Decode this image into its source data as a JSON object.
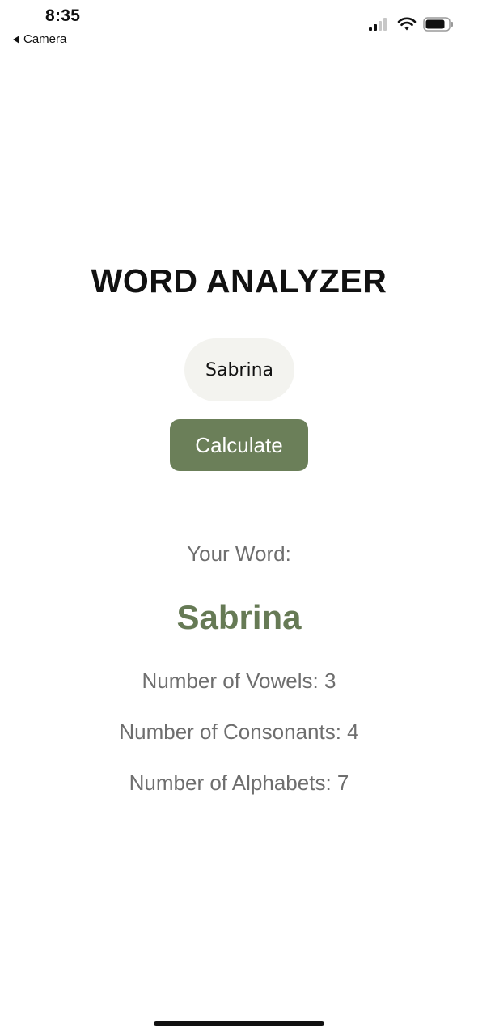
{
  "status_bar": {
    "time": "8:35",
    "back_label": "Camera",
    "icons": [
      "signal-icon",
      "wifi-icon",
      "battery-icon"
    ]
  },
  "app": {
    "title": "WORD ANALYZER",
    "input_value": "Sabrina",
    "calculate_label": "Calculate"
  },
  "result": {
    "label": "Your Word:",
    "word": "Sabrina",
    "vowels_line": "Number of Vowels: 3",
    "consonants_line": "Number of Consonants: 4",
    "alphabets_line": "Number of Alphabets: 7"
  },
  "colors": {
    "accent": "#6b7f59",
    "result_word": "#667a55",
    "input_background": "#f3f3ef",
    "secondary_text": "#6e6e6e"
  }
}
